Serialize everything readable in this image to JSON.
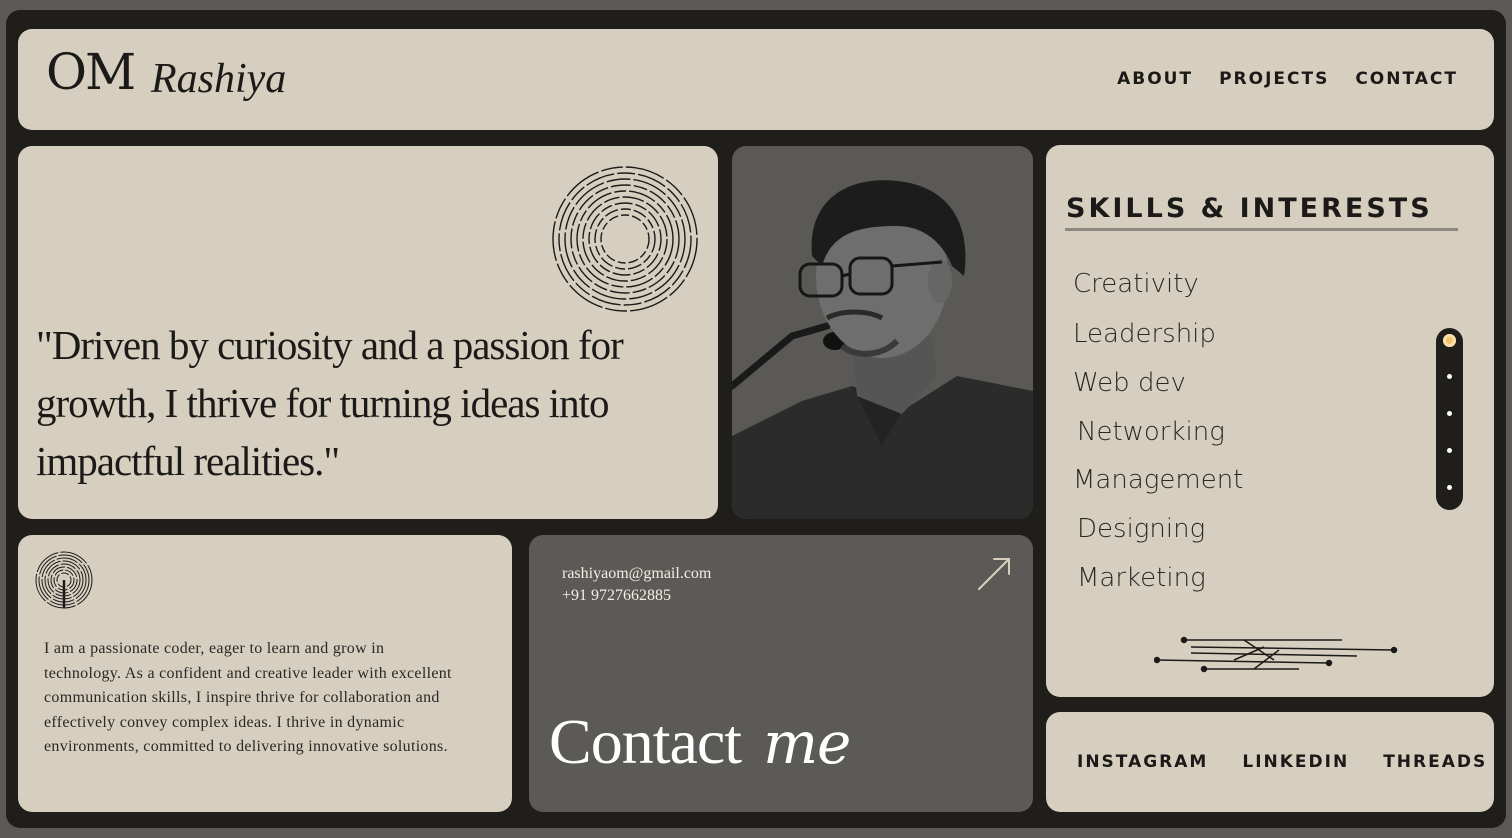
{
  "header": {
    "logo_mark": "OM",
    "logo_name": "Rashiya",
    "nav": [
      "ABOUT",
      "PROJECTS",
      "CONTACT"
    ]
  },
  "hero": {
    "quote": "\"Driven by curiosity and a passion for growth, I thrive for turning ideas into impactful realities.\""
  },
  "skills": {
    "title": "SKILLS & INTERESTS",
    "items": [
      "Creativity",
      "Leadership",
      "Web dev",
      "Networking",
      "Management",
      "Designing",
      "Marketing"
    ],
    "scroll_dots": 5,
    "active_dot": 0
  },
  "about": {
    "text": "I am a passionate coder, eager to learn and grow in technology. As a confident and creative leader with excellent communication skills, I inspire thrive for collaboration and effectively convey complex ideas. I thrive in dynamic environments, committed to delivering innovative solutions."
  },
  "contact": {
    "email": "rashiyaom@gmail.com",
    "phone": "+91 9727662885",
    "heading": "Contact",
    "heading_italic": "me"
  },
  "socials": [
    "INSTAGRAM",
    "LINKEDIN",
    "THREADS"
  ],
  "colors": {
    "background": "#5b5a56",
    "frame": "#1f1e1b",
    "card": "#d6cfbf",
    "dark_card": "#5b5a56",
    "accent_dot": "#f3c36a"
  },
  "icons": {
    "spiral": "concentric-dashed-circles-icon",
    "about": "fingerprint-spiral-icon",
    "arrow": "arrow-up-right-icon",
    "circuit": "circuit-lines-icon"
  }
}
